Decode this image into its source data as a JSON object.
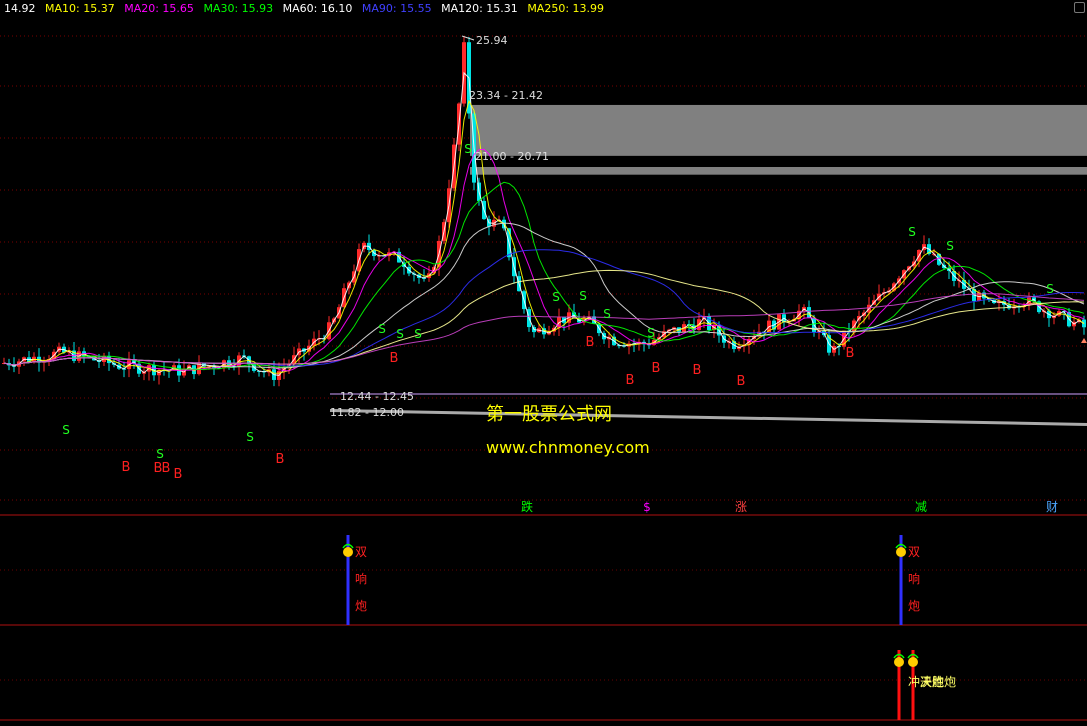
{
  "header": {
    "items": [
      {
        "text": "14.92",
        "color": "#ffffff"
      },
      {
        "text": "MA10: 15.37",
        "color": "#ffff00"
      },
      {
        "text": "MA20: 15.65",
        "color": "#ff00ff"
      },
      {
        "text": "MA30: 15.93",
        "color": "#00ff00"
      },
      {
        "text": "MA60: 16.10",
        "color": "#ffffff"
      },
      {
        "text": "MA90: 15.55",
        "color": "#4040ff"
      },
      {
        "text": "MA120: 15.31",
        "color": "#ffffff"
      },
      {
        "text": "MA250: 13.99",
        "color": "#ffff00"
      }
    ]
  },
  "chart_data": [
    {
      "type": "candlestick",
      "title": "",
      "price_annotations": [
        "25.94",
        "23.34 - 21.42",
        "21.00 - 20.71",
        "12.44 - 12.45",
        "11.82 - 12.00"
      ],
      "band_ranges": [
        [
          21.42,
          23.34
        ],
        [
          20.71,
          21.0
        ]
      ],
      "line_levels": [
        12.44,
        11.82
      ],
      "peak_high": 25.94,
      "watermark": [
        "第一股票公式网",
        "www.chnmoney.com"
      ],
      "buy_label": "B",
      "sell_label": "S",
      "colors": {
        "up": "#ff2a2a",
        "down": "#00e5e5",
        "band": "#808080",
        "buy": "#ff2020",
        "sell": "#20ff20"
      }
    },
    {
      "type": "signal-indicator",
      "labels": [
        {
          "text": "跌",
          "color": "#00ff00"
        },
        {
          "text": "$",
          "color": "#ff00ff"
        },
        {
          "text": "涨",
          "color": "#ff4040"
        },
        {
          "text": "减",
          "color": "#00ff00"
        },
        {
          "text": "财",
          "color": "#4da6ff"
        }
      ]
    },
    {
      "type": "signal-indicator",
      "label": "双响炮",
      "color": "#ff2020",
      "bar_color": "#3030ff"
    },
    {
      "type": "signal-indicator",
      "label": "冲天炮",
      "label_overlap": "决胜炮",
      "color": "#ffff66",
      "bar_color": "#ff1010"
    }
  ]
}
